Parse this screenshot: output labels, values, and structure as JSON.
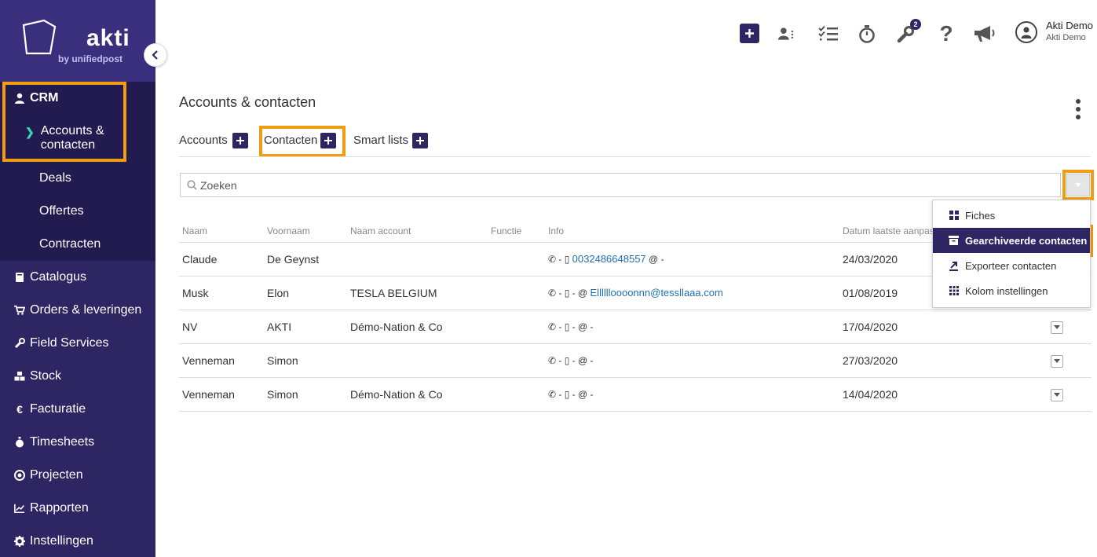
{
  "brand": {
    "name": "akti",
    "sub": "by unifiedpost"
  },
  "sidebar": {
    "crm_label": "CRM",
    "crm_items": [
      {
        "label": "Accounts & contacten",
        "line1": "Accounts &",
        "line2": "contacten",
        "active": true
      },
      {
        "label": "Deals"
      },
      {
        "label": "Offertes"
      },
      {
        "label": "Contracten"
      }
    ],
    "items": [
      {
        "label": "Catalogus",
        "icon": "book-icon"
      },
      {
        "label": "Orders & leveringen",
        "icon": "cart-icon"
      },
      {
        "label": "Field Services",
        "icon": "wrench-icon"
      },
      {
        "label": "Stock",
        "icon": "cubes-icon"
      },
      {
        "label": "Facturatie",
        "icon": "euro-icon"
      },
      {
        "label": "Timesheets",
        "icon": "stopwatch-icon"
      },
      {
        "label": "Projecten",
        "icon": "target-icon"
      },
      {
        "label": "Rapporten",
        "icon": "chart-line-icon"
      },
      {
        "label": "Instellingen",
        "icon": "gear-icon"
      }
    ]
  },
  "topbar": {
    "badge_count": "2",
    "user_name": "Akti Demo",
    "user_company": "Akti Demo",
    "icons": [
      "plus-icon",
      "contacts-list-icon",
      "tasks-icon",
      "stopwatch-icon",
      "wrench-icon",
      "help-icon",
      "megaphone-icon",
      "user-icon"
    ]
  },
  "page": {
    "title": "Accounts & contacten",
    "tabs": [
      {
        "label": "Accounts"
      },
      {
        "label": "Contacten",
        "active": true
      },
      {
        "label": "Smart lists"
      }
    ],
    "search_placeholder": "Zoeken"
  },
  "table": {
    "columns": [
      "Naam",
      "Voornaam",
      "Naam account",
      "Functie",
      "Info",
      "Datum laatste aanpassing"
    ],
    "rows": [
      {
        "naam": "Claude",
        "voornaam": "De Geynst",
        "account": "",
        "functie": "",
        "info_prefix": "- ▯ ",
        "phone": "0032486648557",
        "info_suffix": " @ -",
        "email": "",
        "datum": "24/03/2020"
      },
      {
        "naam": "Musk",
        "voornaam": "Elon",
        "account": "TESLA BELGIUM",
        "functie": "",
        "info_prefix": "- ▯ - @ ",
        "phone": "",
        "info_suffix": "",
        "email": "Elllllloooonnn@tessllaaa.com",
        "datum": "01/08/2019"
      },
      {
        "naam": "NV",
        "voornaam": "AKTI",
        "account": "Démo-Nation & Co",
        "functie": "",
        "info_prefix": "- ▯ - @ -",
        "phone": "",
        "info_suffix": "",
        "email": "",
        "datum": "17/04/2020"
      },
      {
        "naam": "Venneman",
        "voornaam": "Simon",
        "account": "",
        "functie": "",
        "info_prefix": "- ▯ - @ -",
        "phone": "",
        "info_suffix": "",
        "email": "",
        "datum": "27/03/2020"
      },
      {
        "naam": "Venneman",
        "voornaam": "Simon",
        "account": "Démo-Nation & Co",
        "functie": "",
        "info_prefix": "- ▯ - @ -",
        "phone": "",
        "info_suffix": "",
        "email": "",
        "datum": "14/04/2020"
      }
    ]
  },
  "menu": {
    "items": [
      {
        "label": "Fiches",
        "icon": "grid-icon"
      },
      {
        "label": "Gearchiveerde contacten",
        "icon": "archive-icon",
        "active": true
      },
      {
        "label": "Exporteer contacten",
        "icon": "export-icon"
      },
      {
        "label": "Kolom instellingen",
        "icon": "columns-icon"
      }
    ]
  },
  "colors": {
    "sidebar": "#2e2563",
    "sidebar_dark": "#221b4f",
    "accent": "#3fd3b6",
    "highlight": "#f39c12",
    "link": "#1f6fb2"
  }
}
